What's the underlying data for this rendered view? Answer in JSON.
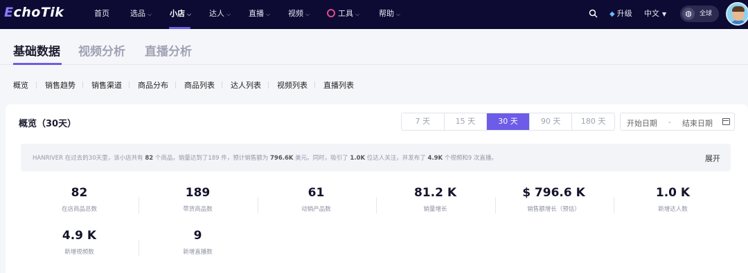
{
  "brand": {
    "logo_e": "E",
    "logo_rest": "choTik"
  },
  "nav": {
    "items": [
      {
        "label": "首页",
        "chevron": false
      },
      {
        "label": "选品",
        "chevron": true
      },
      {
        "label": "小店",
        "chevron": true
      },
      {
        "label": "达人",
        "chevron": true
      },
      {
        "label": "直播",
        "chevron": true
      },
      {
        "label": "视频",
        "chevron": true
      },
      {
        "label": "工具",
        "chevron": true
      },
      {
        "label": "帮助",
        "chevron": true
      }
    ],
    "active": "小店",
    "upgrade": "升级",
    "language": "中文",
    "region": "全球"
  },
  "section_tabs": [
    {
      "label": "基础数据",
      "active": true
    },
    {
      "label": "视频分析",
      "active": false
    },
    {
      "label": "直播分析",
      "active": false
    }
  ],
  "subnav": [
    "概览",
    "销售趋势",
    "销售渠道",
    "商品分布",
    "商品列表",
    "达人列表",
    "视频列表",
    "直播列表"
  ],
  "overview": {
    "title": "概览（30天）",
    "ranges": [
      "7 天",
      "15 天",
      "30 天",
      "90 天",
      "180 天"
    ],
    "active_range": "30 天",
    "start_date_placeholder": "开始日期",
    "separator": "-",
    "end_date_placeholder": "结束日期",
    "summary": {
      "shop": "HANRIVER",
      "p1": " 在过去的30天里，该小店共有 ",
      "products": "82",
      "p2": " 个商品，销量达到了189 件，预计销售额为 ",
      "sales": "796.6K",
      "p3": " 美元。同时，吸引了 ",
      "creators": "1.0K",
      "p4": " 位达人关注，并发布了 ",
      "videos": "4.9K",
      "p5": " 个视频和9 次直播。"
    },
    "expand": "展开",
    "metrics": [
      {
        "value": "82",
        "label": "在店商品总数"
      },
      {
        "value": "189",
        "label": "带货商品数"
      },
      {
        "value": "61",
        "label": "动销产品数"
      },
      {
        "value": "81.2 K",
        "label": "销量增长"
      },
      {
        "value": "$ 796.6 K",
        "label": "销售额增长（预估）"
      },
      {
        "value": "1.0 K",
        "label": "新增达人数"
      },
      {
        "value": "4.9 K",
        "label": "新增视频数"
      },
      {
        "value": "9",
        "label": "新增直播数"
      }
    ]
  },
  "colors": {
    "nav_bg": "#0d0b33",
    "accent": "#6c5ce7"
  }
}
